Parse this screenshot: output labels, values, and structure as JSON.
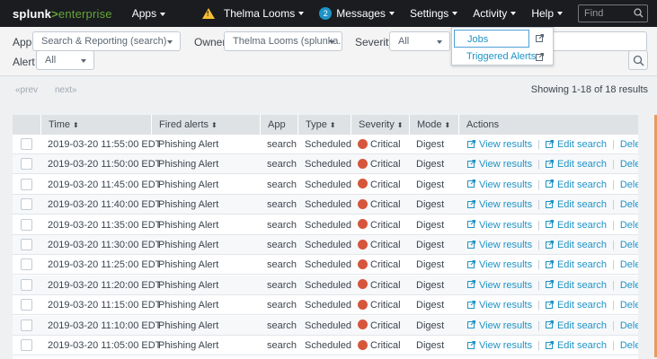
{
  "topbar": {
    "logo_main": "splunk",
    "logo_gt": ">",
    "logo_ent": "enterprise",
    "apps": "Apps",
    "user": "Thelma Looms",
    "messages_count": "2",
    "messages": "Messages",
    "settings": "Settings",
    "activity": "Activity",
    "help": "Help",
    "find_placeholder": "Find"
  },
  "filters": {
    "app_label": "App",
    "app_value": "Search & Reporting (search)",
    "owner_label": "Owner",
    "owner_value": "Thelma Looms (splunka...",
    "severity_label": "Severity",
    "severity_value": "All",
    "alert_label": "Alert",
    "alert_value": "All"
  },
  "activity_menu": {
    "items": [
      {
        "label": "Jobs"
      },
      {
        "label": "Triggered Alerts"
      }
    ]
  },
  "pager": {
    "prev": "«prev",
    "next": "next»",
    "showing": "Showing 1-18 of 18 results"
  },
  "table": {
    "headers": {
      "time": "Time",
      "fired_alerts": "Fired alerts",
      "app": "App",
      "type": "Type",
      "severity": "Severity",
      "mode": "Mode",
      "actions": "Actions"
    },
    "sort_glyph": "⬍",
    "actions": {
      "view": "View results",
      "edit": "Edit search",
      "delete": "Delete",
      "sep": "|"
    },
    "rows": [
      {
        "time": "2019-03-20 11:55:00 EDT",
        "alert": "Phishing Alert",
        "app": "search",
        "type": "Scheduled",
        "severity": "Critical",
        "mode": "Digest"
      },
      {
        "time": "2019-03-20 11:50:00 EDT",
        "alert": "Phishing Alert",
        "app": "search",
        "type": "Scheduled",
        "severity": "Critical",
        "mode": "Digest"
      },
      {
        "time": "2019-03-20 11:45:00 EDT",
        "alert": "Phishing Alert",
        "app": "search",
        "type": "Scheduled",
        "severity": "Critical",
        "mode": "Digest"
      },
      {
        "time": "2019-03-20 11:40:00 EDT",
        "alert": "Phishing Alert",
        "app": "search",
        "type": "Scheduled",
        "severity": "Critical",
        "mode": "Digest"
      },
      {
        "time": "2019-03-20 11:35:00 EDT",
        "alert": "Phishing Alert",
        "app": "search",
        "type": "Scheduled",
        "severity": "Critical",
        "mode": "Digest"
      },
      {
        "time": "2019-03-20 11:30:00 EDT",
        "alert": "Phishing Alert",
        "app": "search",
        "type": "Scheduled",
        "severity": "Critical",
        "mode": "Digest"
      },
      {
        "time": "2019-03-20 11:25:00 EDT",
        "alert": "Phishing Alert",
        "app": "search",
        "type": "Scheduled",
        "severity": "Critical",
        "mode": "Digest"
      },
      {
        "time": "2019-03-20 11:20:00 EDT",
        "alert": "Phishing Alert",
        "app": "search",
        "type": "Scheduled",
        "severity": "Critical",
        "mode": "Digest"
      },
      {
        "time": "2019-03-20 11:15:00 EDT",
        "alert": "Phishing Alert",
        "app": "search",
        "type": "Scheduled",
        "severity": "Critical",
        "mode": "Digest"
      },
      {
        "time": "2019-03-20 11:10:00 EDT",
        "alert": "Phishing Alert",
        "app": "search",
        "type": "Scheduled",
        "severity": "Critical",
        "mode": "Digest"
      },
      {
        "time": "2019-03-20 11:05:00 EDT",
        "alert": "Phishing Alert",
        "app": "search",
        "type": "Scheduled",
        "severity": "Critical",
        "mode": "Digest"
      }
    ]
  },
  "colors": {
    "critical": "#d6563c",
    "link": "#1e93c6",
    "brand_green": "#65a637"
  }
}
